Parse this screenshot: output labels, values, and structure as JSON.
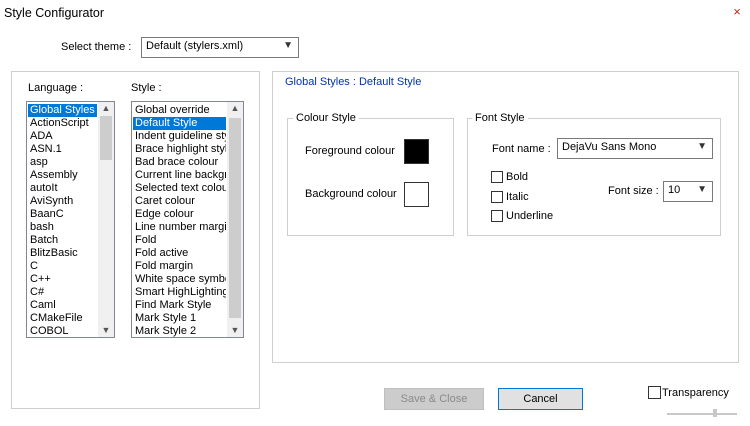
{
  "window": {
    "title": "Style Configurator",
    "close_glyph": "×"
  },
  "theme": {
    "label": "Select theme :",
    "value": "Default (stylers.xml)"
  },
  "language": {
    "label": "Language :",
    "items": [
      "Global Styles",
      "ActionScript",
      "ADA",
      "ASN.1",
      "asp",
      "Assembly",
      "autoIt",
      "AviSynth",
      "BaanC",
      "bash",
      "Batch",
      "BlitzBasic",
      "C",
      "C++",
      "C#",
      "Caml",
      "CMakeFile",
      "COBOL"
    ],
    "selected_index": 0
  },
  "style": {
    "label": "Style :",
    "items": [
      "Global override",
      "Default Style",
      "Indent guideline style",
      "Brace highlight style",
      "Bad brace colour",
      "Current line background",
      "Selected text colour",
      "Caret colour",
      "Edge colour",
      "Line number margin",
      "Fold",
      "Fold active",
      "Fold margin",
      "White space symbol",
      "Smart HighLighting",
      "Find Mark Style",
      "Mark Style 1",
      "Mark Style 2"
    ],
    "selected_index": 1
  },
  "details": {
    "title": "Global Styles : Default Style"
  },
  "colour_style": {
    "legend": "Colour Style",
    "foreground_label": "Foreground colour",
    "foreground_color": "#000000",
    "background_label": "Background colour",
    "background_color": "#ffffff"
  },
  "font_style": {
    "legend": "Font Style",
    "font_name_label": "Font name :",
    "font_name_value": "DejaVu Sans Mono",
    "bold_label": "Bold",
    "italic_label": "Italic",
    "underline_label": "Underline",
    "font_size_label": "Font size :",
    "font_size_value": "10"
  },
  "buttons": {
    "save_close": "Save & Close",
    "cancel": "Cancel"
  },
  "transparency": {
    "label": "Transparency"
  }
}
